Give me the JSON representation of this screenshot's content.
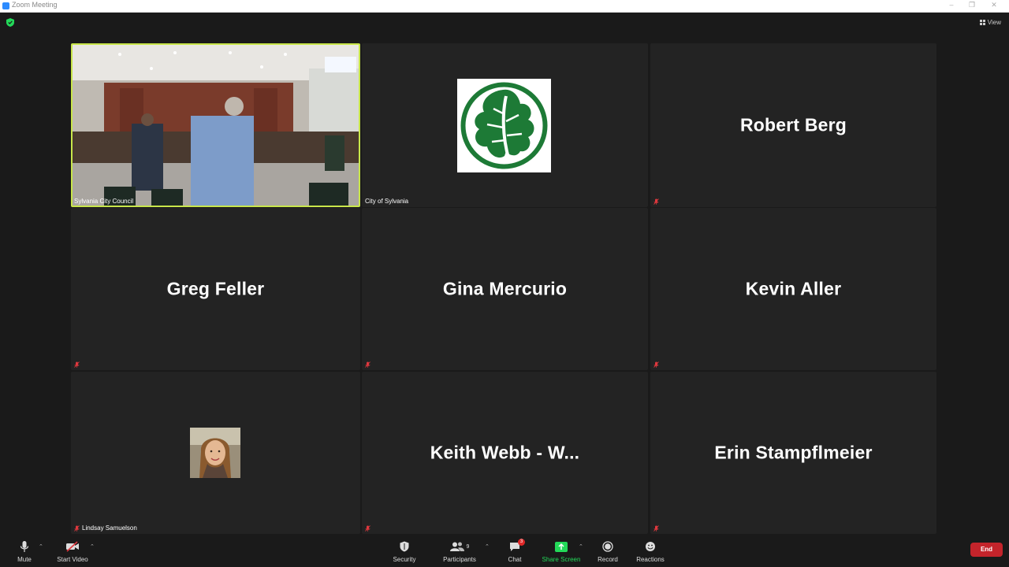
{
  "window": {
    "title": "Zoom Meeting"
  },
  "view": {
    "label": "View"
  },
  "tiles": [
    {
      "label": "Sylvania City Council",
      "name": "",
      "muted": false,
      "kind": "video",
      "active": true
    },
    {
      "label": "City of Sylvania",
      "name": "",
      "muted": false,
      "kind": "logo"
    },
    {
      "label": "",
      "name": "Robert Berg",
      "muted": true,
      "kind": "name"
    },
    {
      "label": "",
      "name": "Greg Feller",
      "muted": true,
      "kind": "name"
    },
    {
      "label": "",
      "name": "Gina Mercurio",
      "muted": true,
      "kind": "name"
    },
    {
      "label": "",
      "name": "Kevin Aller",
      "muted": true,
      "kind": "name"
    },
    {
      "label": "Lindsay Samuelson",
      "name": "",
      "muted": true,
      "kind": "photo"
    },
    {
      "label": "",
      "name": "Keith Webb - W...",
      "muted": true,
      "kind": "name"
    },
    {
      "label": "",
      "name": "Erin Stampflmeier",
      "muted": true,
      "kind": "name"
    }
  ],
  "toolbar": {
    "mute": "Mute",
    "start_video": "Start Video",
    "security": "Security",
    "participants": "Participants",
    "participants_count": "9",
    "chat": "Chat",
    "chat_badge": "3",
    "share_screen": "Share Screen",
    "record": "Record",
    "reactions": "Reactions",
    "end": "End"
  },
  "colors": {
    "active_border": "#c8e64a",
    "share_green": "#23d959",
    "end_red": "#c4242b",
    "logo_green": "#1d7a36"
  }
}
